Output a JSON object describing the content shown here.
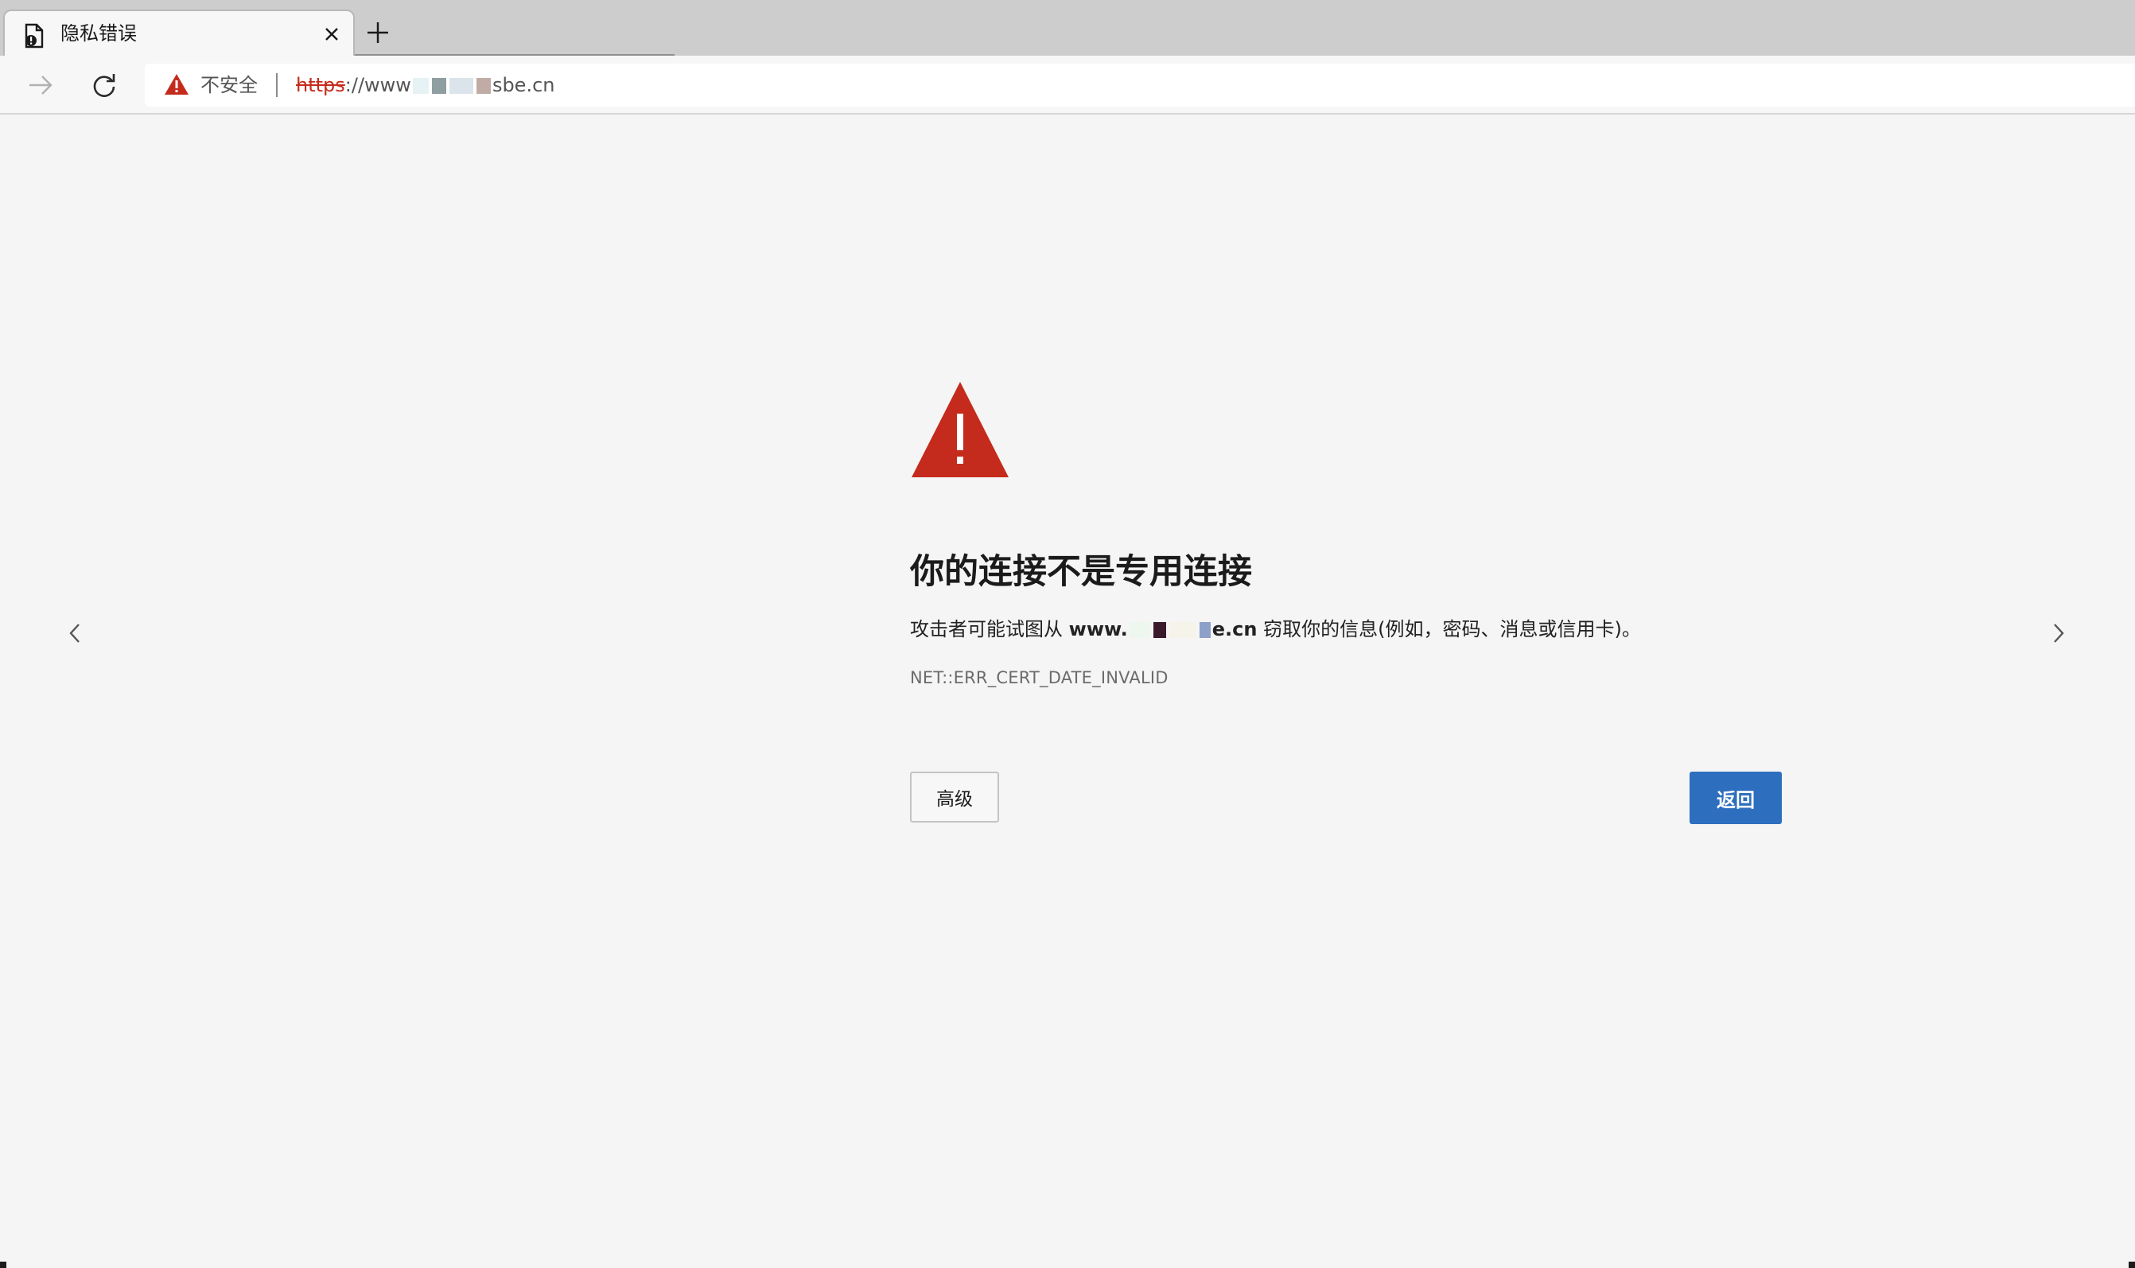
{
  "tab": {
    "title": "隐私错误",
    "icon": "document-warning-icon",
    "close_icon": "close-icon",
    "new_tab_icon": "plus-icon"
  },
  "toolbar": {
    "forward_icon": "arrow-right-icon",
    "reload_icon": "refresh-icon",
    "security_label": "不安全",
    "url_scheme": "https",
    "url_sep": "://",
    "url_host_prefix": "www",
    "url_host_suffix": "sbe.cn"
  },
  "page": {
    "heading": "你的连接不是专用连接",
    "desc_prefix": "攻击者可能试图从 ",
    "desc_host_prefix": "www.",
    "desc_host_suffix": "e.cn",
    "desc_suffix": " 窃取你的信息(例如，密码、消息或信用卡)。",
    "error_code": "NET::ERR_CERT_DATE_INVALID",
    "advanced_label": "高级",
    "back_label": "返回"
  },
  "colors": {
    "warning_red": "#c42b1c",
    "primary_blue": "#2d6fbe",
    "page_bg": "#f5f5f5"
  }
}
